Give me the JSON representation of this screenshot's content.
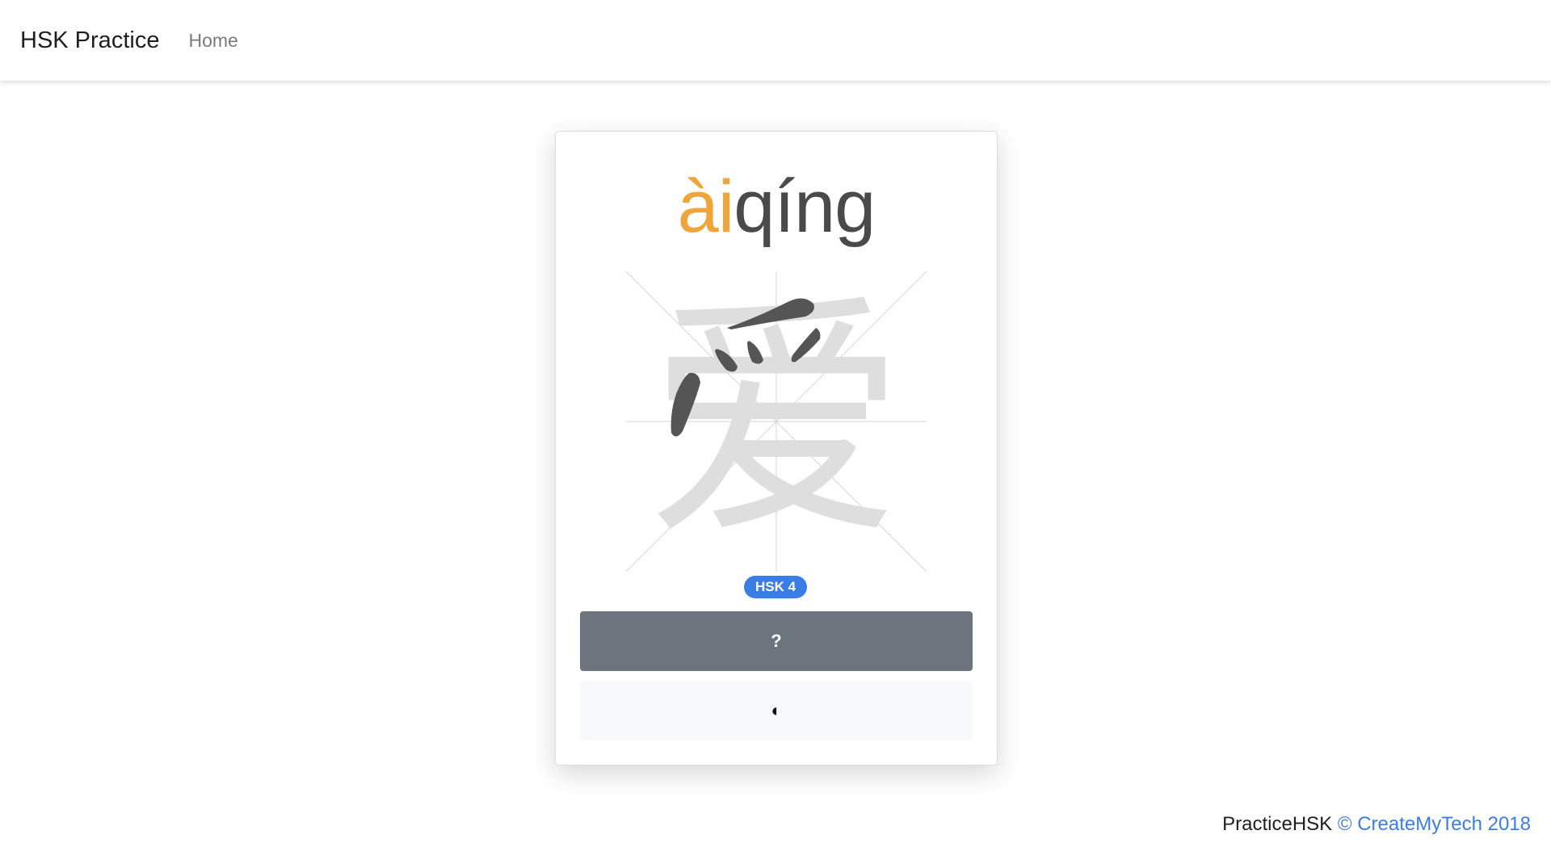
{
  "nav": {
    "brand": "HSK Practice",
    "home_label": "Home"
  },
  "card": {
    "pinyin_syllables": [
      "ài",
      "qíng"
    ],
    "character": "爱",
    "level_badge": "HSK 4",
    "reveal_button_label": "?",
    "toggle_button_label": "◐"
  },
  "footer": {
    "site_name": "PracticeHSK",
    "copyright": "© CreateMyTech 2018"
  },
  "colors": {
    "pinyin_highlight": "#efa53c",
    "pinyin_default": "#4a4a4a",
    "badge": "#3b7de6",
    "reveal_button": "#6c757d",
    "toggle_button": "#f8f9fa",
    "link": "#3b7de6"
  }
}
